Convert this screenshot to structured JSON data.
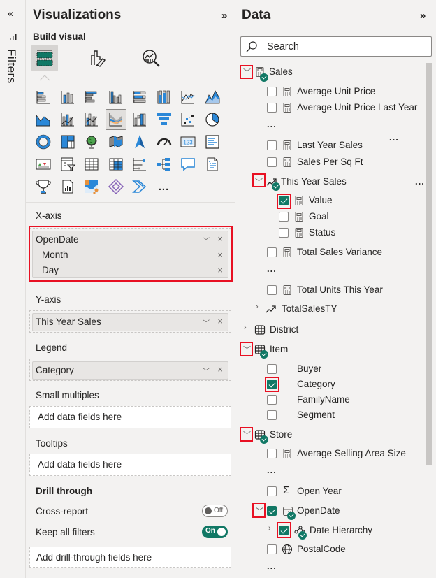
{
  "filters": {
    "collapse_icon": "double-chevron-left",
    "label": "Filters"
  },
  "visualizations": {
    "title": "Visualizations",
    "expand_icon": "double-chevron-right",
    "build_visual_label": "Build visual",
    "modes": [
      {
        "name": "build-visual",
        "icon": "fields-icon",
        "active": true
      },
      {
        "name": "format-visual",
        "icon": "format-brush-icon",
        "active": false
      },
      {
        "name": "analytics",
        "icon": "analytics-magnifier-icon",
        "active": false
      }
    ],
    "visual_types": [
      "stacked-bar-chart",
      "stacked-column-chart",
      "clustered-bar-chart",
      "clustered-column-chart",
      "100-stacked-bar-chart",
      "100-stacked-column-chart",
      "line-chart",
      "area-chart",
      "stacked-area-chart",
      "line-and-stacked-column-chart",
      "line-and-clustered-column-chart",
      "ribbon-chart",
      "waterfall-chart",
      "funnel-chart",
      "scatter-chart",
      "pie-chart",
      "donut-chart",
      "treemap",
      "map",
      "filled-map",
      "azure-map",
      "gauge",
      "card",
      "multi-row-card",
      "kpi",
      "slicer",
      "table",
      "matrix",
      "key-influencers",
      "decomposition-tree",
      "qa",
      "smart-narrative",
      "metrics",
      "paginated-report",
      "power-apps",
      "power-automate",
      "more-visuals"
    ],
    "selected_visual": "ribbon-chart",
    "more_label": "...",
    "wells": {
      "x_axis": {
        "label": "X-axis",
        "field": "OpenDate",
        "sub_fields": [
          "Month",
          "Day"
        ]
      },
      "y_axis": {
        "label": "Y-axis",
        "field": "This Year Sales"
      },
      "legend": {
        "label": "Legend",
        "field": "Category"
      },
      "small_multiples": {
        "label": "Small multiples",
        "placeholder": "Add data fields here"
      },
      "tooltips": {
        "label": "Tooltips",
        "placeholder": "Add data fields here"
      }
    },
    "drill_through": {
      "label": "Drill through",
      "cross_report": {
        "label": "Cross-report",
        "state": "Off"
      },
      "keep_all_filters": {
        "label": "Keep all filters",
        "state": "On"
      },
      "placeholder": "Add drill-through fields here"
    }
  },
  "data": {
    "title": "Data",
    "expand_icon": "double-chevron-right",
    "search_placeholder": "Search",
    "ellipsis": "...",
    "tables": {
      "sales": {
        "name": "Sales",
        "expanded": true,
        "has_selection": true,
        "fields": {
          "avg_unit_price": "Average Unit Price",
          "avg_unit_price_ly": "Average Unit Price Last Year",
          "last_year_sales": "Last Year Sales",
          "sales_per_sqft": "Sales Per Sq Ft",
          "this_year_sales": {
            "name": "This Year Sales",
            "type": "kpi",
            "expanded": true,
            "children": {
              "value": "Value",
              "goal": "Goal",
              "status": "Status"
            },
            "value_checked": true
          },
          "total_sales_variance": "Total Sales Variance",
          "total_units_ty": "Total Units This Year",
          "total_sales_ty": "TotalSalesTY"
        }
      },
      "district": {
        "name": "District",
        "expanded": false
      },
      "item": {
        "name": "Item",
        "expanded": true,
        "has_selection": true,
        "fields": {
          "buyer": "Buyer",
          "category": "Category",
          "family_name": "FamilyName",
          "segment": "Segment"
        },
        "checked": [
          "Category"
        ]
      },
      "store": {
        "name": "Store",
        "expanded": true,
        "has_selection": true,
        "fields": {
          "avg_selling_area": "Average Selling Area Size",
          "open_year": "Open Year",
          "open_date": "OpenDate",
          "date_hierarchy": "Date Hierarchy",
          "postal_code": "PostalCode"
        },
        "checked": [
          "OpenDate",
          "Date Hierarchy"
        ]
      }
    }
  },
  "colors": {
    "accent": "#117865",
    "highlight": "#e81123",
    "visual_blue": "#2b88d8"
  }
}
